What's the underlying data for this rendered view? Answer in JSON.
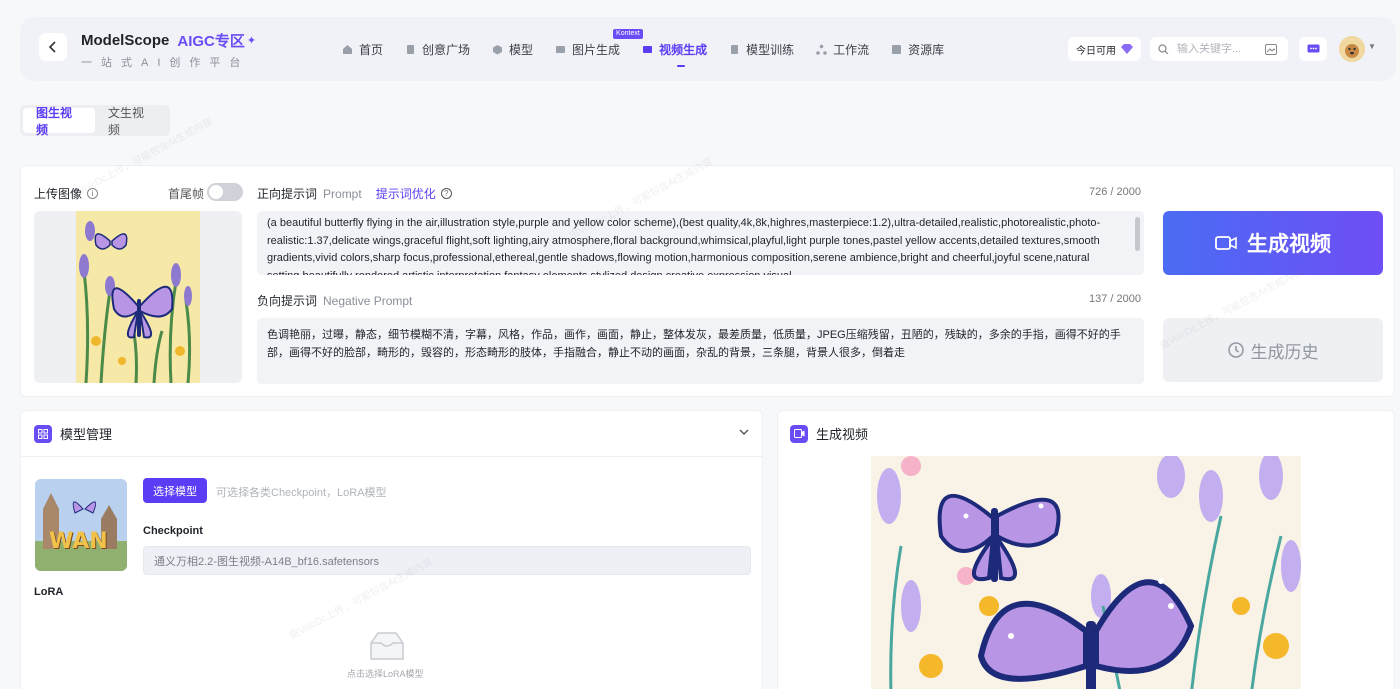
{
  "header": {
    "brand_name": "ModelScope",
    "brand_aigc": "AIGC专区",
    "brand_subtitle": "一站式AI创作平台",
    "nav": [
      {
        "label": "首页",
        "icon": "home-icon"
      },
      {
        "label": "创意广场",
        "icon": "creative-square-icon"
      },
      {
        "label": "模型",
        "icon": "model-cube-icon"
      },
      {
        "label": "图片生成",
        "icon": "image-gen-icon",
        "badge": "Kontext"
      },
      {
        "label": "视频生成",
        "icon": "video-gen-icon",
        "active": true
      },
      {
        "label": "模型训练",
        "icon": "training-icon"
      },
      {
        "label": "工作流",
        "icon": "workflow-icon"
      },
      {
        "label": "资源库",
        "icon": "library-icon"
      }
    ],
    "daily_label": "今日可用",
    "search_placeholder": "输入关键字..."
  },
  "mode_tabs": [
    "图生视频",
    "文生视频"
  ],
  "upload": {
    "label": "上传图像",
    "first_last_frame_label": "首尾帧"
  },
  "prompt": {
    "label": "正向提示词",
    "sublabel": "Prompt",
    "optimize_link": "提示词优化",
    "counter": "726 / 2000",
    "text": "(a beautiful butterfly flying in the air,illustration style,purple and yellow color scheme),(best quality,4k,8k,highres,masterpiece:1.2),ultra-detailed,realistic,photorealistic,photo-realistic:1.37,delicate wings,graceful flight,soft lighting,airy atmosphere,floral background,whimsical,playful,light purple tones,pastel yellow accents,detailed textures,smooth gradients,vivid colors,sharp focus,professional,ethereal,gentle shadows,flowing motion,harmonious composition,serene ambience,bright and cheerful,joyful scene,natural setting,beautifully rendered,artistic interpretation,fantasy elements,stylized design,creative expression,visual"
  },
  "negative_prompt": {
    "label": "负向提示词",
    "sublabel": "Negative Prompt",
    "counter": "137 / 2000",
    "text": "色调艳丽，过曝，静态，细节模糊不清，字幕，风格，作品，画作，画面，静止，整体发灰，最差质量，低质量，JPEG压缩残留，丑陋的，残缺的，多余的手指，画得不好的手部，画得不好的脸部，畸形的，毁容的，形态畸形的肢体，手指融合，静止不动的画面，杂乱的背景，三条腿，背景人很多，倒着走"
  },
  "actions": {
    "generate_label": "生成视频",
    "history_label": "生成历史"
  },
  "model_panel": {
    "title": "模型管理",
    "select_button": "选择模型",
    "hint": "可选择各类Checkpoint，LoRA模型",
    "checkpoint_label": "Checkpoint",
    "checkpoint_value": "通义万相2.2-图生视频-A14B_bf16.safetensors",
    "lora_label": "LoRA",
    "lora_empty": "点击选择LoRA模型"
  },
  "output_panel": {
    "title": "生成视频"
  },
  "colors": {
    "accent": "#5b3df5",
    "gradient_start": "#4a6cf3",
    "gradient_end": "#6f4ef5"
  }
}
